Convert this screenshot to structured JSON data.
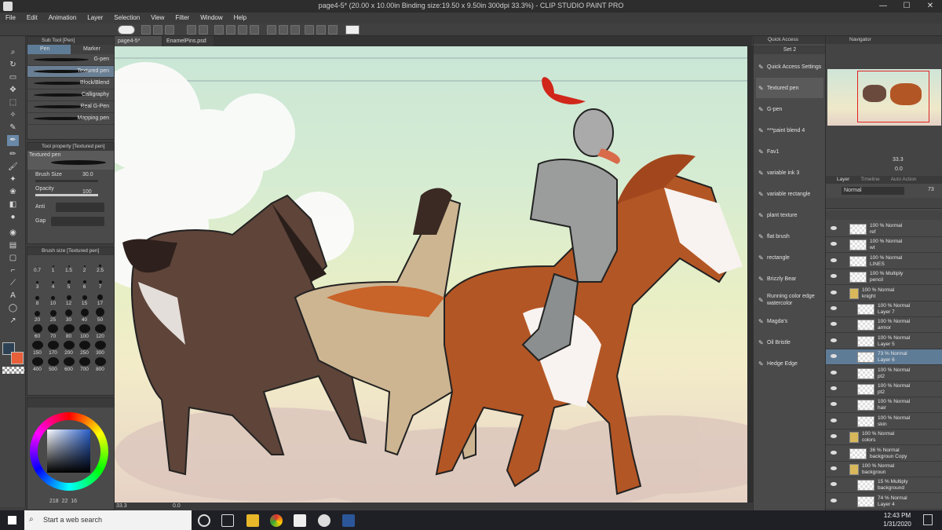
{
  "window": {
    "title": "page4-5* (20.00 x 10.00in Binding size:19.50 x 9.50in 300dpi 33.3%) - CLIP STUDIO PAINT PRO",
    "minimize": "—",
    "maximize": "☐",
    "close": "✕"
  },
  "menu": [
    "File",
    "Edit",
    "Animation",
    "Layer",
    "Selection",
    "View",
    "Filter",
    "Window",
    "Help"
  ],
  "subtool": {
    "title": "Sub Tool [Pen]",
    "tabs": [
      "Pen",
      "Marker"
    ],
    "brushes": [
      "G-pen",
      "Textured pen",
      "Block/Blend",
      "Calligraphy",
      "Real G-Pen",
      "Mapping pen"
    ]
  },
  "toolprop": {
    "title": "Tool property [Textured pen]",
    "brush_name": "Textured pen",
    "brush_size_label": "Brush Size",
    "brush_size_value": "30.0",
    "opacity_label": "Opacity",
    "opacity_value": "100",
    "anti_label": "Anti",
    "gap_label": "Gap"
  },
  "brushsize": {
    "title": "Brush size [Textured pen]",
    "sizes": [
      "0.7",
      "1",
      "1.5",
      "2",
      "2.5",
      "3",
      "4",
      "5",
      "6",
      "7",
      "8",
      "10",
      "12",
      "15",
      "17",
      "20",
      "25",
      "30",
      "40",
      "50",
      "60",
      "70",
      "80",
      "100",
      "120",
      "150",
      "170",
      "200",
      "250",
      "300",
      "400",
      "500",
      "600",
      "700",
      "800"
    ]
  },
  "color": {
    "main": "#2d4154",
    "sub": "#e8603a",
    "readout": "218",
    "readout2": "22",
    "readout3": "16"
  },
  "doc_tabs": [
    "page4-5*",
    "EnamelPins.psd"
  ],
  "canvas_status": {
    "zoom": "33.3",
    "angle": "0.0"
  },
  "quick_access": {
    "title": "Quick Access",
    "set": "Set 2",
    "items": [
      "Quick Access Settings",
      "Textured pen",
      "G-pen",
      "***paint blend 4",
      "Fav1",
      "variable ink 3",
      "variable rectangle",
      "plant texture",
      "flat brush",
      "rectangle",
      "Brizzly Bear",
      "Running color edge watercolor",
      "Magda's",
      "Oil Bristle",
      "Hedge Edge"
    ]
  },
  "navigator": {
    "title": "Navigator",
    "zoom": "33.3",
    "angle": "0.0"
  },
  "layer_panel": {
    "tabs": [
      "Layer",
      "Timeline",
      "Auto Action"
    ],
    "blend": "Normal",
    "opacity": "73",
    "layers": [
      {
        "line1": "100 % Normal",
        "line2": "ref"
      },
      {
        "line1": "100 % Normal",
        "line2": "wt"
      },
      {
        "line1": "100 % Normal",
        "line2": "LINES"
      },
      {
        "line1": "100 % Multiply",
        "line2": "pencil"
      },
      {
        "line1": "100 % Normal",
        "line2": "knight"
      },
      {
        "line1": "100 % Normal",
        "line2": "Layer 7"
      },
      {
        "line1": "100 % Normal",
        "line2": "armor"
      },
      {
        "line1": "100 % Normal",
        "line2": "Layer 5"
      },
      {
        "line1": "73 % Normal",
        "line2": "Layer 6"
      },
      {
        "line1": "100 % Normal",
        "line2": "pt2"
      },
      {
        "line1": "100 % Normal",
        "line2": "pt2"
      },
      {
        "line1": "100 % Normal",
        "line2": "hair"
      },
      {
        "line1": "100 % Normal",
        "line2": "skin"
      },
      {
        "line1": "100 % Normal",
        "line2": "colors"
      },
      {
        "line1": "36 % Normal",
        "line2": "backgroun Copy"
      },
      {
        "line1": "100 % Normal",
        "line2": "backgroun"
      },
      {
        "line1": "15 % Multiply",
        "line2": "background"
      },
      {
        "line1": "74 % Normal",
        "line2": "Layer 4"
      }
    ]
  },
  "taskbar": {
    "search_placeholder": "Start a web search",
    "time": "12:43 PM",
    "date": "1/31/2020"
  }
}
